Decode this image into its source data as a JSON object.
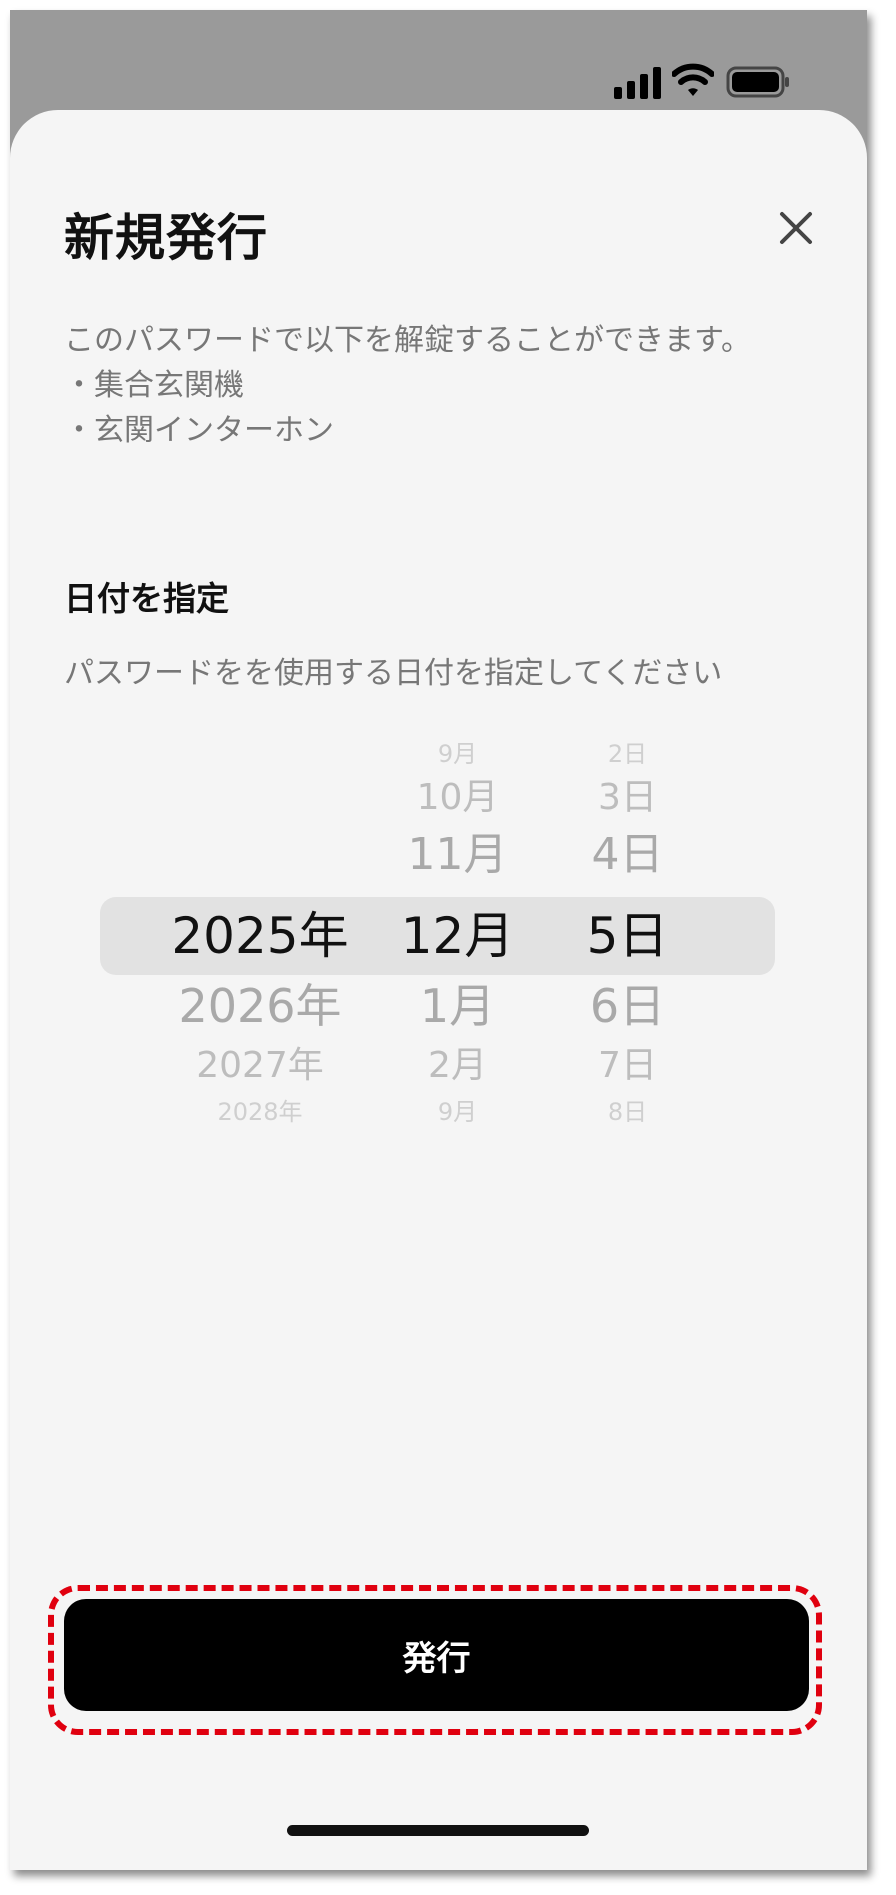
{
  "status_bar": {
    "icons": [
      "cellular-signal-icon",
      "wifi-icon",
      "battery-icon"
    ]
  },
  "sheet": {
    "title": "新規発行",
    "close_icon": "close-icon",
    "description": {
      "intro": "このパスワードで以下を解錠することができます。",
      "items": [
        "・集合玄関機",
        "・玄関インターホン"
      ]
    },
    "date_section": {
      "title": "日付を指定",
      "subtitle": "パスワードをを使用する日付を指定してください"
    },
    "date_picker": {
      "years": [
        "2025年",
        "2026年",
        "2027年",
        "2028年"
      ],
      "months": [
        "9月",
        "10月",
        "11月",
        "12月",
        "1月",
        "2月",
        "9月"
      ],
      "days": [
        "2日",
        "3日",
        "4日",
        "5日",
        "6日",
        "7日",
        "8日"
      ],
      "selected": {
        "year": "2025年",
        "month": "12月",
        "day": "5日"
      }
    },
    "issue_button": {
      "label": "発行"
    }
  },
  "colors": {
    "highlight_outline": "#e0000f",
    "button_bg": "#000000",
    "sheet_bg": "#f5f5f5"
  }
}
